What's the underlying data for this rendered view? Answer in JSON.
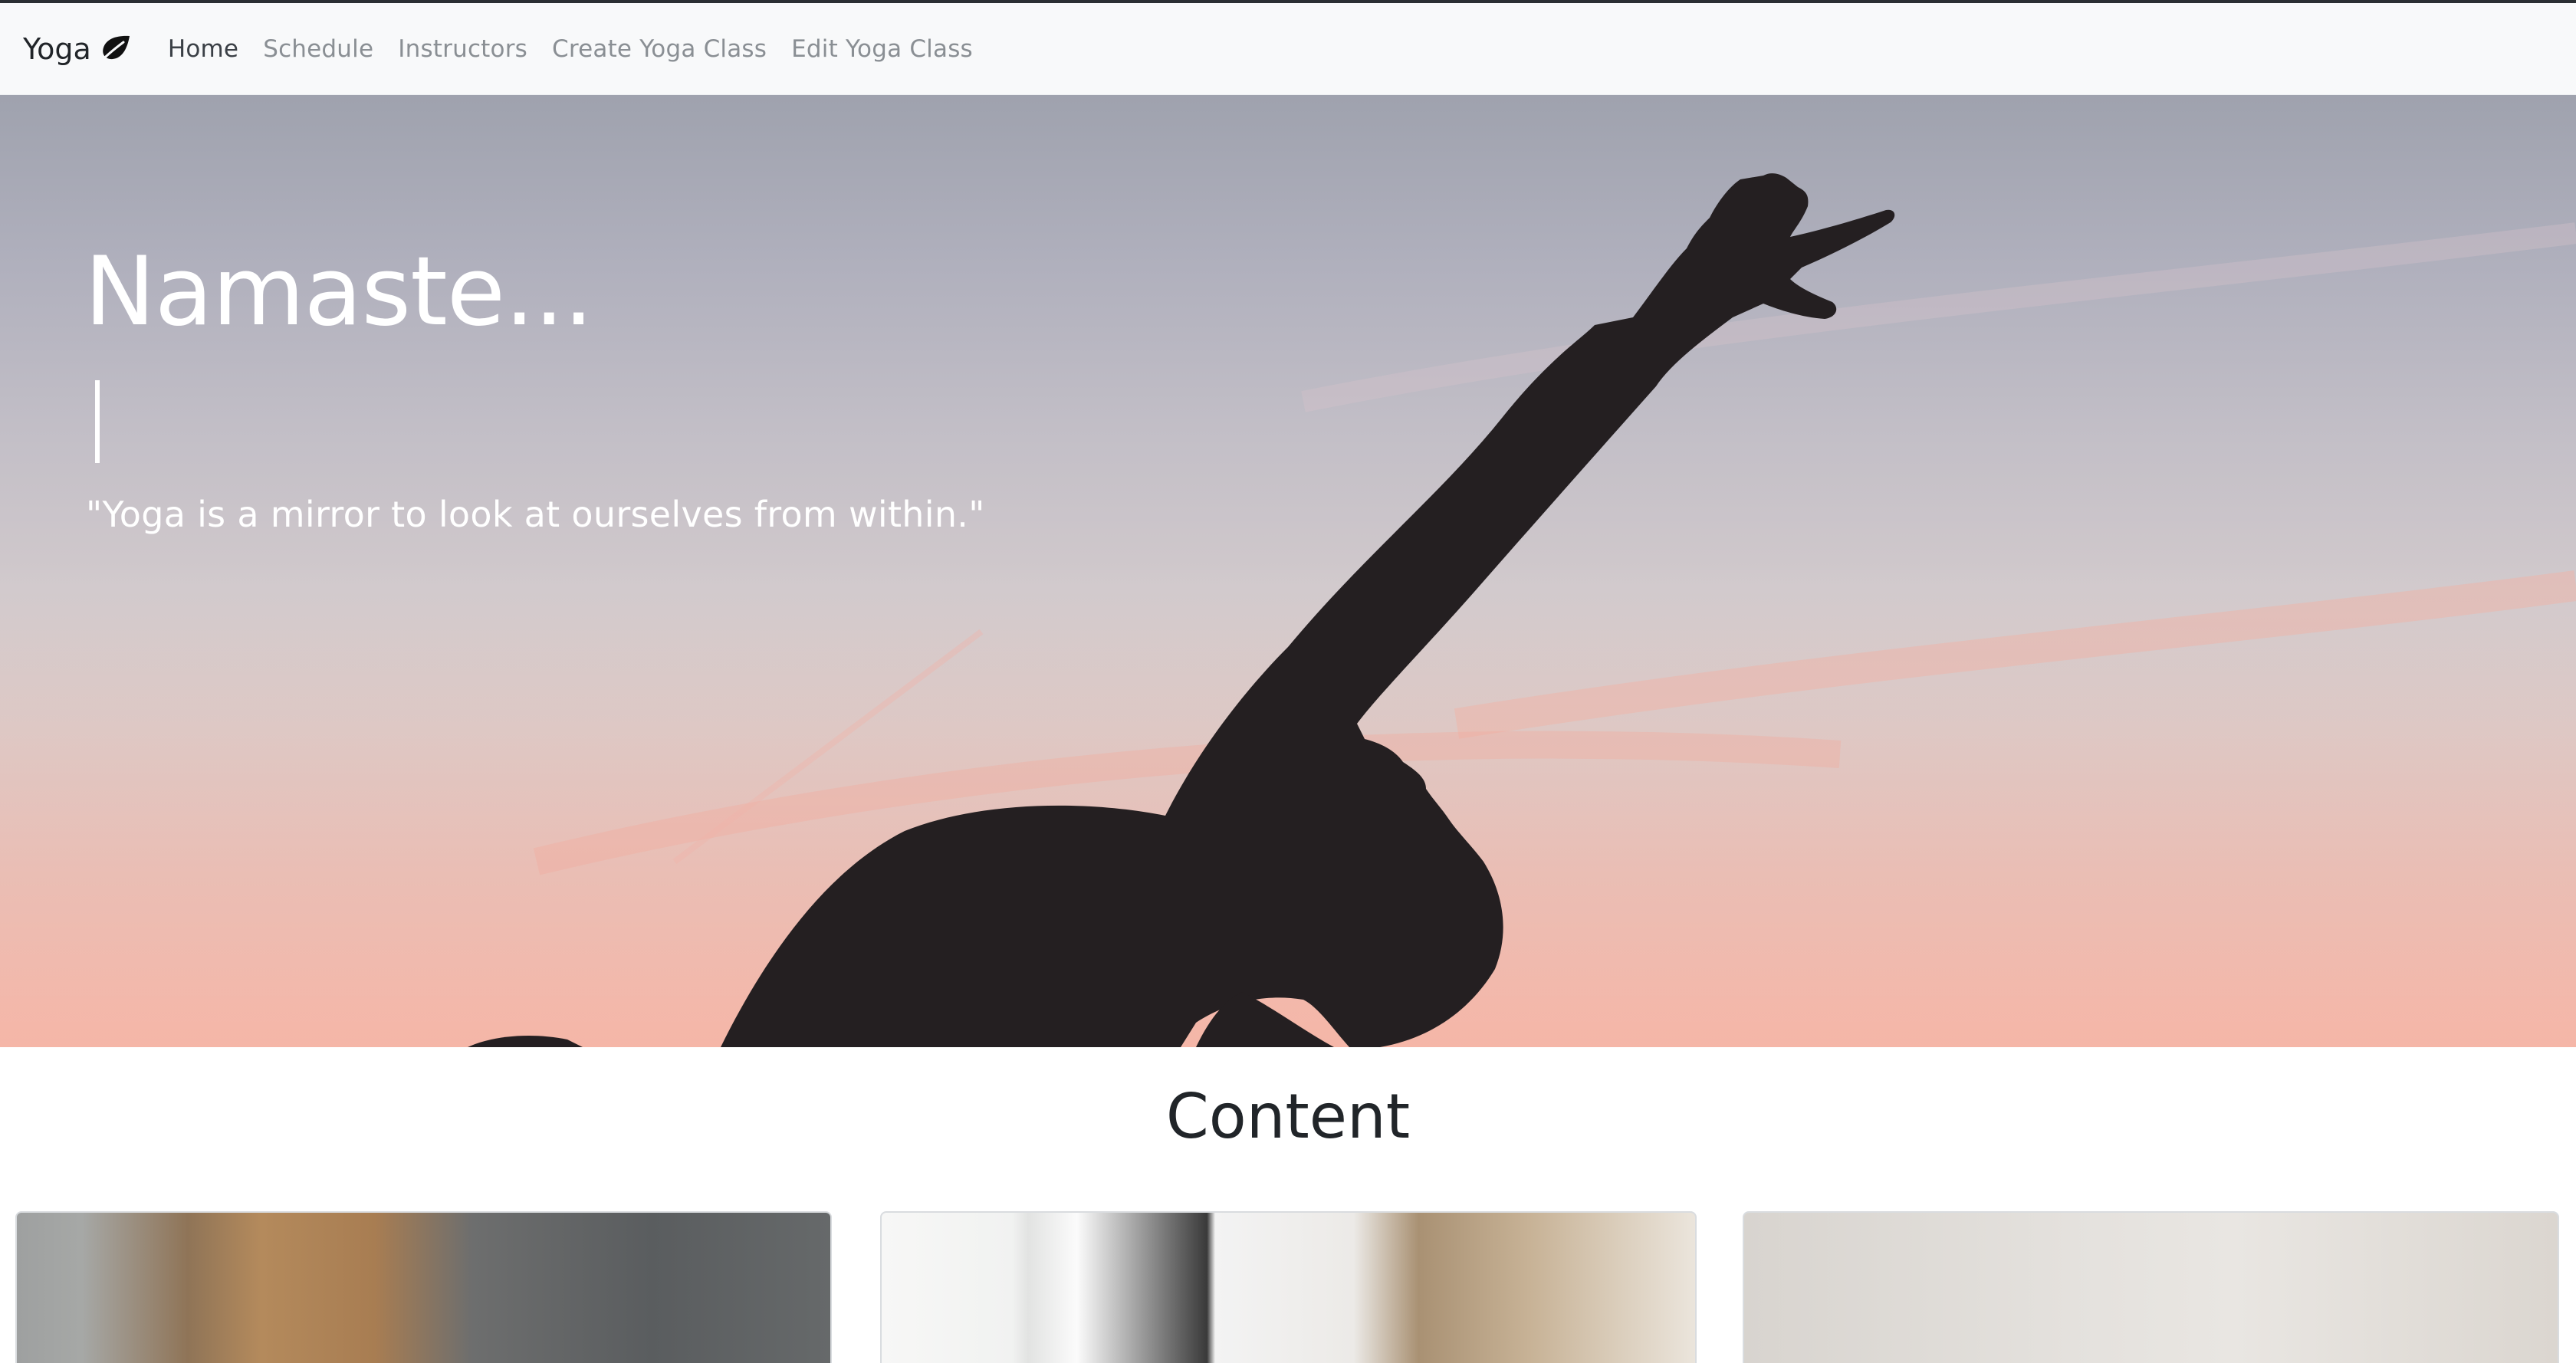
{
  "navbar": {
    "brand": "Yoga",
    "brand_icon": "leaf-icon",
    "links": [
      {
        "label": "Home",
        "active": true
      },
      {
        "label": "Schedule",
        "active": false
      },
      {
        "label": "Instructors",
        "active": false
      },
      {
        "label": "Create Yoga Class",
        "active": false
      },
      {
        "label": "Edit Yoga Class",
        "active": false
      }
    ]
  },
  "hero": {
    "title": "Namaste...",
    "quote": "\"Yoga is a mirror to look at ourselves from within.\""
  },
  "content": {
    "heading": "Content"
  },
  "colors": {
    "navbar_bg": "#f8f9fa",
    "hero_text": "#ffffff",
    "silhouette": "#241f21"
  }
}
